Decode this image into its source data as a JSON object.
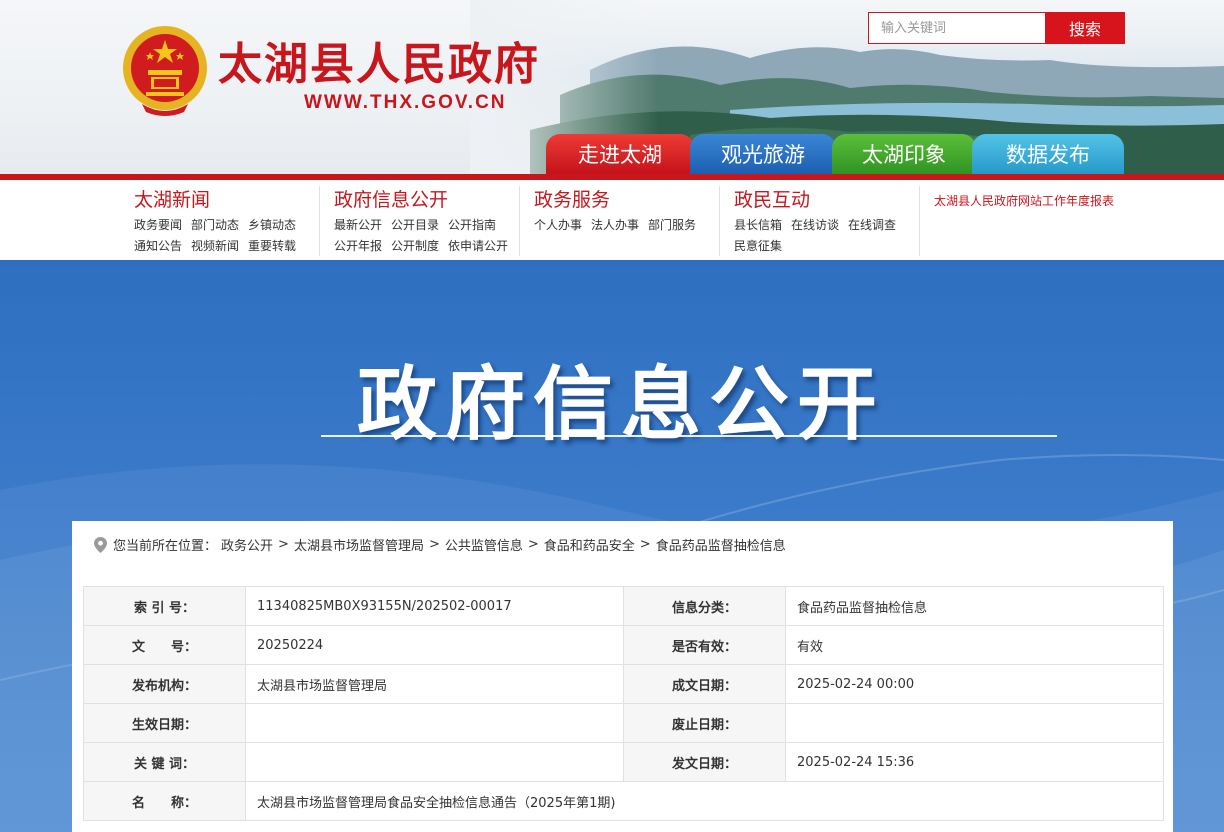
{
  "header": {
    "site_title": "太湖县人民政府",
    "site_url": "WWW.THX.GOV.CN",
    "search_placeholder": "输入关键词",
    "search_button": "搜索",
    "tabs": [
      {
        "label": "走进太湖",
        "color": "#d7141c"
      },
      {
        "label": "观光旅游",
        "color": "#2a72c6"
      },
      {
        "label": "太湖印象",
        "color": "#41a92c"
      },
      {
        "label": "数据发布",
        "color": "#35aedb"
      }
    ]
  },
  "nav": {
    "columns": [
      {
        "title": "太湖新闻",
        "links": [
          "政务要闻",
          "部门动态",
          "乡镇动态",
          "通知公告",
          "视频新闻",
          "重要转载"
        ]
      },
      {
        "title": "政府信息公开",
        "links": [
          "最新公开",
          "公开目录",
          "公开指南",
          "公开年报",
          "公开制度",
          "依申请公开"
        ]
      },
      {
        "title": "政务服务",
        "links": [
          "个人办事",
          "法人办事",
          "部门服务"
        ]
      },
      {
        "title": "政民互动",
        "links": [
          "县长信箱",
          "在线访谈",
          "在线调查",
          "民意征集"
        ]
      }
    ],
    "report_link": "太湖县人民政府网站工作年度报表"
  },
  "banner": {
    "title": "政府信息公开"
  },
  "breadcrumb": {
    "prefix": "您当前所在位置：",
    "items": [
      "政务公开",
      "太湖县市场监督管理局",
      "公共监管信息",
      "食品和药品安全",
      "食品药品监督抽检信息"
    ],
    "separator": ">"
  },
  "info_table": {
    "rows": [
      {
        "label1": "索 引 号：",
        "value1": "11340825MB0X93155N/202502-00017",
        "label2": "信息分类：",
        "value2": "食品药品监督抽检信息"
      },
      {
        "label1": "文　　号：",
        "value1": "20250224",
        "label2": "是否有效：",
        "value2": "有效"
      },
      {
        "label1": "发布机构：",
        "value1": "太湖县市场监督管理局",
        "label2": "成文日期：",
        "value2": "2025-02-24 00:00"
      },
      {
        "label1": "生效日期：",
        "value1": "",
        "label2": "废止日期：",
        "value2": ""
      },
      {
        "label1": "关 键 词：",
        "value1": "",
        "label2": "发文日期：",
        "value2": "2025-02-24 15:36"
      }
    ],
    "name_row": {
      "label": "名　　称：",
      "value": "太湖县市场监督管理局食品安全抽检信息通告（2025年第1期)"
    }
  },
  "colors": {
    "brand_red": "#c8161d",
    "banner_blue": "#3b7bca"
  }
}
